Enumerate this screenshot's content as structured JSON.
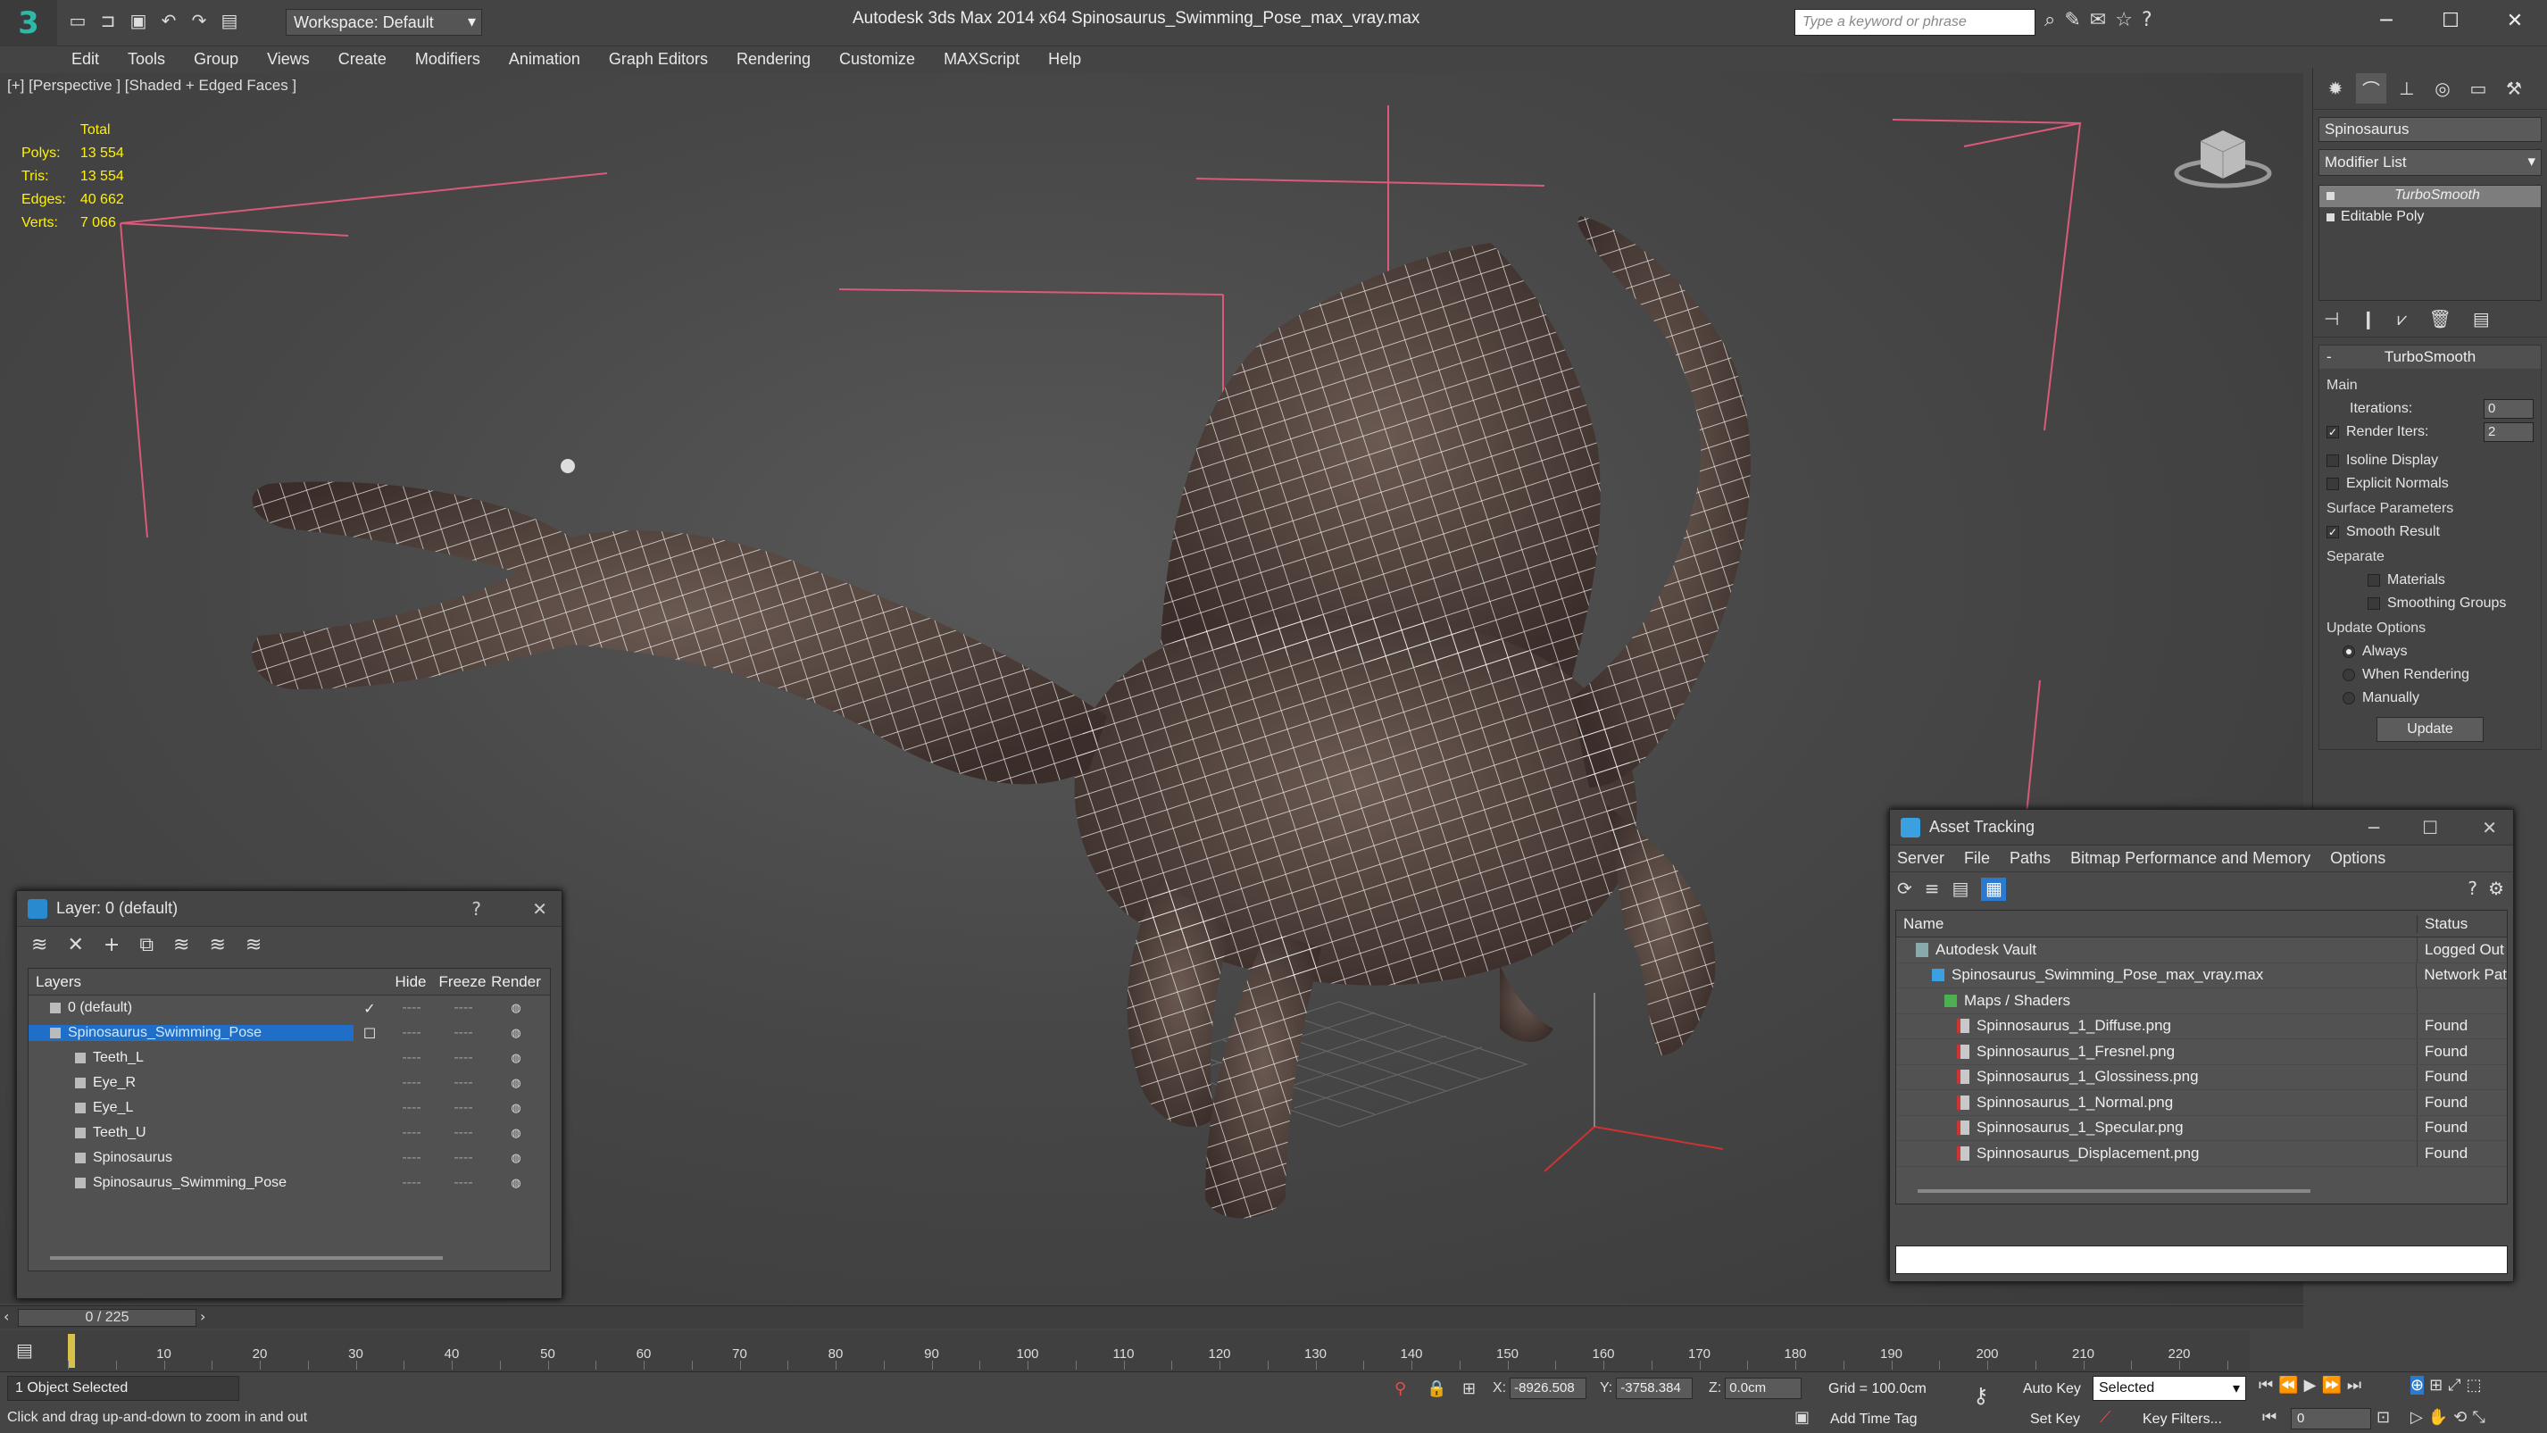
{
  "app": {
    "title": "Autodesk 3ds Max  2014 x64     Spinosaurus_Swimming_Pose_max_vray.max",
    "workspace": "Workspace: Default",
    "search_placeholder": "Type a keyword or phrase"
  },
  "menu": [
    "Edit",
    "Tools",
    "Group",
    "Views",
    "Create",
    "Modifiers",
    "Animation",
    "Graph Editors",
    "Rendering",
    "Customize",
    "MAXScript",
    "Help"
  ],
  "viewport": {
    "label": "[+] [Perspective ] [Shaded + Edged Faces ]",
    "stats": {
      "header": "Total",
      "rows": [
        {
          "label": "Polys:",
          "value": "13 554"
        },
        {
          "label": "Tris:",
          "value": "13 554"
        },
        {
          "label": "Edges:",
          "value": "40 662"
        },
        {
          "label": "Verts:",
          "value": "7 066"
        }
      ]
    }
  },
  "command_panel": {
    "object_name": "Spinosaurus",
    "modifier_list": "Modifier List",
    "stack": [
      "TurboSmooth",
      "Editable Poly"
    ],
    "rollout_title": "TurboSmooth",
    "main_label": "Main",
    "iterations_label": "Iterations:",
    "iterations_value": "0",
    "render_iters_label": "Render Iters:",
    "render_iters_value": "2",
    "isoline": "Isoline Display",
    "explicit": "Explicit Normals",
    "surface_params": "Surface Parameters",
    "smooth_result": "Smooth Result",
    "separate": "Separate",
    "materials": "Materials",
    "smoothing_groups": "Smoothing Groups",
    "update_options": "Update Options",
    "always": "Always",
    "when_rendering": "When Rendering",
    "manually": "Manually",
    "update": "Update"
  },
  "layer_dialog": {
    "title": "Layer: 0 (default)",
    "help": "?",
    "columns": [
      "Layers",
      "Hide",
      "Freeze",
      "Render"
    ],
    "rows": [
      {
        "name": "0 (default)",
        "level": 0,
        "selected": false,
        "check": "✓"
      },
      {
        "name": "Spinosaurus_Swimming_Pose",
        "level": 0,
        "selected": true,
        "check": "☐"
      },
      {
        "name": "Teeth_L",
        "level": 1,
        "selected": false,
        "check": ""
      },
      {
        "name": "Eye_R",
        "level": 1,
        "selected": false,
        "check": ""
      },
      {
        "name": "Eye_L",
        "level": 1,
        "selected": false,
        "check": ""
      },
      {
        "name": "Teeth_U",
        "level": 1,
        "selected": false,
        "check": ""
      },
      {
        "name": "Spinosaurus",
        "level": 1,
        "selected": false,
        "check": ""
      },
      {
        "name": "Spinosaurus_Swimming_Pose",
        "level": 1,
        "selected": false,
        "check": ""
      }
    ],
    "dash": "----"
  },
  "asset_dialog": {
    "title": "Asset Tracking",
    "menu": [
      "Server",
      "File",
      "Paths",
      "Bitmap Performance and Memory",
      "Options"
    ],
    "columns": [
      "Name",
      "Status"
    ],
    "rows": [
      {
        "name": "Autodesk Vault",
        "status": "Logged Out",
        "indent": 1,
        "icon": "vault"
      },
      {
        "name": "Spinosaurus_Swimming_Pose_max_vray.max",
        "status": "Network Pat",
        "indent": 2,
        "icon": "max"
      },
      {
        "name": "Maps / Shaders",
        "status": "",
        "indent": 3,
        "icon": "maps"
      },
      {
        "name": "Spinnosaurus_1_Diffuse.png",
        "status": "Found",
        "indent": 4,
        "icon": "png"
      },
      {
        "name": "Spinnosaurus_1_Fresnel.png",
        "status": "Found",
        "indent": 4,
        "icon": "png"
      },
      {
        "name": "Spinnosaurus_1_Glossiness.png",
        "status": "Found",
        "indent": 4,
        "icon": "png"
      },
      {
        "name": "Spinnosaurus_1_Normal.png",
        "status": "Found",
        "indent": 4,
        "icon": "png"
      },
      {
        "name": "Spinnosaurus_1_Specular.png",
        "status": "Found",
        "indent": 4,
        "icon": "png"
      },
      {
        "name": "Spinnosaurus_Displacement.png",
        "status": "Found",
        "indent": 4,
        "icon": "png"
      }
    ]
  },
  "timeline": {
    "frame": "0 / 225",
    "ticks": [
      "10",
      "20",
      "30",
      "40",
      "50",
      "60",
      "70",
      "80",
      "90",
      "100",
      "110",
      "120",
      "130",
      "140",
      "150",
      "160",
      "170",
      "180",
      "190",
      "200",
      "210",
      "220"
    ]
  },
  "status": {
    "selection": "1 Object Selected",
    "hint": "Click and drag up-and-down to zoom in and out",
    "x_label": "X:",
    "x_value": "-8926.508",
    "y_label": "Y:",
    "y_value": "-3758.384",
    "z_label": "Z:",
    "z_value": "0.0cm",
    "grid": "Grid = 100.0cm",
    "add_time_tag": "Add Time Tag",
    "auto_key": "Auto Key",
    "set_key": "Set Key",
    "selected": "Selected",
    "key_filters": "Key Filters...",
    "frame_value": "0"
  }
}
